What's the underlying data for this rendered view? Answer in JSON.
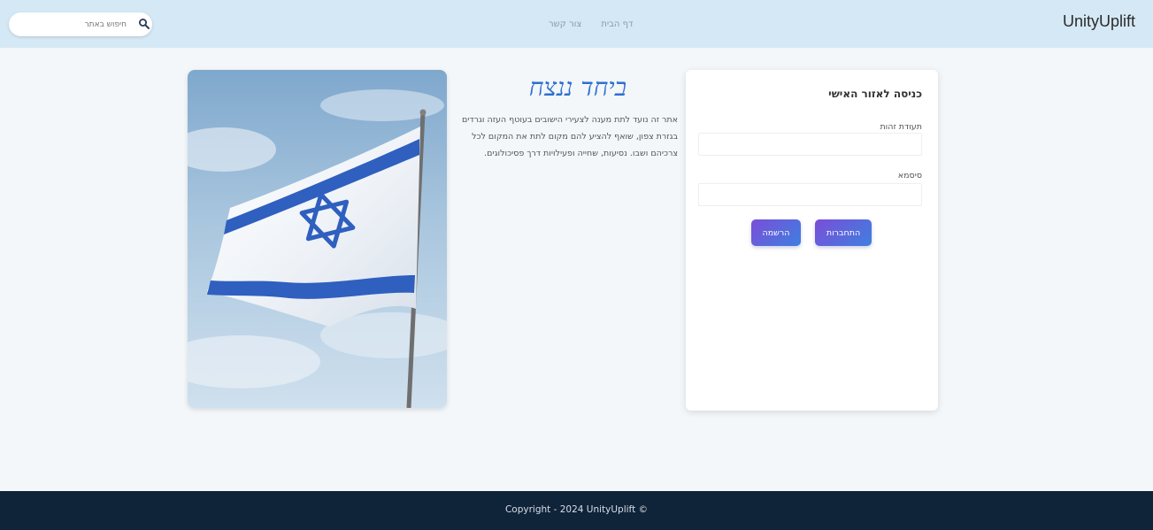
{
  "header": {
    "brand": "UnityUplift",
    "nav": [
      {
        "label": "דף הבית"
      },
      {
        "label": "צור קשר"
      }
    ],
    "search": {
      "placeholder": "חיפוש באתר"
    }
  },
  "intro": {
    "title": "ביחד ננצח",
    "text": "אתר זה נועד לתת מענה לצעירי הישובים בעוטף העזה וגרדים בגזרת צפון, שואף להציע להם מקום לתת את המקום לכל צרכיהם ושבו. נסיעות, שחייה ופעילויות דרך פסיכולוגים."
  },
  "login": {
    "title": "כניסה לאזור האישי",
    "email_label": "תעודת זהות",
    "password_label": "סיסמא",
    "login_button": "התחברות",
    "register_button": "הרשמה"
  },
  "footer": {
    "copyright": "Copyright - 2024 UnityUplift ©"
  },
  "colors": {
    "header_bg": "#d5e8f5",
    "page_bg": "#f3f7fa",
    "footer_bg": "#0f2339",
    "accent": "#2f6fd1",
    "button_gradient_start": "#7a4ed8",
    "button_gradient_end": "#3f7fe0"
  },
  "icons": {
    "search": "search-icon"
  }
}
